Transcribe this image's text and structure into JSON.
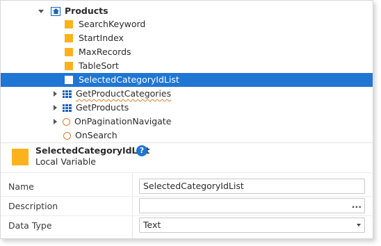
{
  "tree": {
    "root_label": "Products",
    "variables": [
      "SearchKeyword",
      "StartIndex",
      "MaxRecords",
      "TableSort"
    ],
    "selected_label": "SelectedCategoryIdList",
    "aggregates": [
      "GetProductCategories",
      "GetProducts"
    ],
    "actions": [
      "OnPaginationNavigate",
      "OnSearch"
    ]
  },
  "header": {
    "title": "SelectedCategoryIdList",
    "subtitle": "Local Variable",
    "help": "?"
  },
  "properties": {
    "name_label": "Name",
    "name_value": "SelectedCategoryIdList",
    "description_label": "Description",
    "description_value": "",
    "description_more": "...",
    "datatype_label": "Data Type",
    "datatype_value": "Text"
  },
  "colors": {
    "variable_icon": "#fbb21d",
    "selection": "#1f76d3",
    "aggregate_icon": "#1a63b8",
    "action_icon": "#e07a2e"
  }
}
